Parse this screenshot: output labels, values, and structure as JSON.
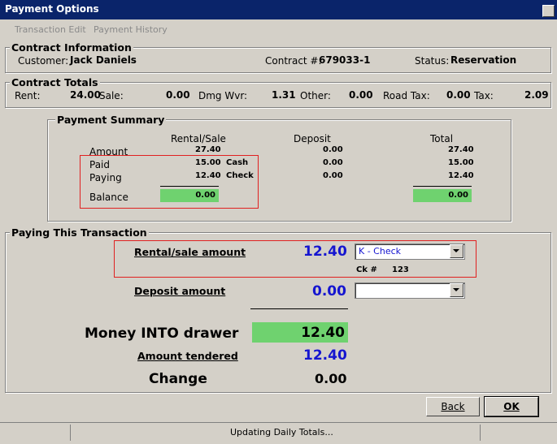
{
  "window": {
    "title": "Payment Options"
  },
  "menu": {
    "items": [
      "Transaction Edit",
      "Payment History"
    ]
  },
  "contract_info": {
    "title": "Contract Information",
    "customer_label": "Customer:",
    "customer_value": "Jack Daniels",
    "contract_label": "Contract #:",
    "contract_value": "679033-1",
    "status_label": "Status:",
    "status_value": "Reservation"
  },
  "contract_totals": {
    "title": "Contract Totals",
    "rent_label": "Rent:",
    "rent_value": "24.00",
    "sale_label": "Sale:",
    "sale_value": "0.00",
    "dmg_label": "Dmg Wvr:",
    "dmg_value": "1.31",
    "other_label": "Other:",
    "other_value": "0.00",
    "road_label": "Road Tax:",
    "road_value": "0.00",
    "tax_label": "Tax:",
    "tax_value": "2.09"
  },
  "payment_summary": {
    "title": "Payment Summary",
    "col_rental": "Rental/Sale",
    "col_deposit": "Deposit",
    "col_total": "Total",
    "row_amount": "Amount",
    "row_paid": "Paid",
    "row_paying": "Paying",
    "row_balance": "Balance",
    "amount_rental": "27.40",
    "amount_deposit": "0.00",
    "amount_total": "27.40",
    "paid_rental": "15.00",
    "paid_method": "Cash",
    "paid_deposit": "0.00",
    "paid_total": "15.00",
    "paying_rental": "12.40",
    "paying_method": "Check",
    "paying_deposit": "0.00",
    "paying_total": "12.40",
    "balance_rental": "0.00",
    "balance_total": "0.00"
  },
  "paying": {
    "title": "Paying This Transaction",
    "rental_label": "Rental/sale amount",
    "rental_value": "12.40",
    "rental_method": "K - Check",
    "check_label": "Ck #",
    "check_value": "123",
    "deposit_label": "Deposit amount",
    "deposit_value": "0.00",
    "deposit_method": "",
    "money_label": "Money INTO drawer",
    "money_value": "12.40",
    "tendered_label": "Amount tendered",
    "tendered_value": "12.40",
    "change_label": "Change",
    "change_value": "0.00"
  },
  "buttons": {
    "back": "Back",
    "ok": "OK"
  },
  "status": {
    "text": "Updating Daily Totals..."
  }
}
